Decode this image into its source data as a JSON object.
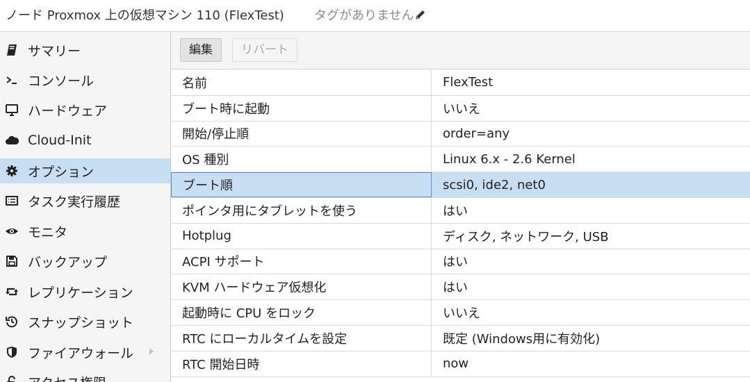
{
  "header": {
    "title": "ノード Proxmox 上の仮想マシン 110 (FlexTest)",
    "tags": "タグがありません"
  },
  "sidebar": {
    "items": [
      {
        "label": "サマリー",
        "icon": "book-icon"
      },
      {
        "label": "コンソール",
        "icon": "terminal-icon"
      },
      {
        "label": "ハードウェア",
        "icon": "monitor-icon"
      },
      {
        "label": "Cloud-Init",
        "icon": "cloud-icon"
      },
      {
        "label": "オプション",
        "icon": "gear-icon"
      },
      {
        "label": "タスク実行履歴",
        "icon": "list-icon"
      },
      {
        "label": "モニタ",
        "icon": "eye-icon"
      },
      {
        "label": "バックアップ",
        "icon": "floppy-icon"
      },
      {
        "label": "レプリケーション",
        "icon": "retweet-icon"
      },
      {
        "label": "スナップショット",
        "icon": "history-icon"
      },
      {
        "label": "ファイアウォール",
        "icon": "shield-icon"
      },
      {
        "label": "アクセス権限",
        "icon": "unlock-icon"
      }
    ],
    "active_index": 4
  },
  "toolbar": {
    "edit_label": "編集",
    "revert_label": "リバート"
  },
  "options": {
    "rows": [
      {
        "name": "名前",
        "value": "FlexTest"
      },
      {
        "name": "ブート時に起動",
        "value": "いいえ"
      },
      {
        "name": "開始/停止順",
        "value": "order=any"
      },
      {
        "name": "OS 種別",
        "value": "Linux 6.x - 2.6 Kernel"
      },
      {
        "name": "ブート順",
        "value": "scsi0, ide2, net0"
      },
      {
        "name": "ポインタ用にタブレットを使う",
        "value": "はい"
      },
      {
        "name": "Hotplug",
        "value": "ディスク, ネットワーク, USB"
      },
      {
        "name": "ACPI サポート",
        "value": "はい"
      },
      {
        "name": "KVM ハードウェア仮想化",
        "value": "はい"
      },
      {
        "name": "起動時に CPU をロック",
        "value": "いいえ"
      },
      {
        "name": "RTC にローカルタイムを設定",
        "value": "既定 (Windows用に有効化)"
      },
      {
        "name": "RTC 開始日時",
        "value": "now"
      }
    ],
    "selected_index": 4
  },
  "colors": {
    "selection": "#c8def2",
    "selection_border": "#5b8fc7"
  }
}
